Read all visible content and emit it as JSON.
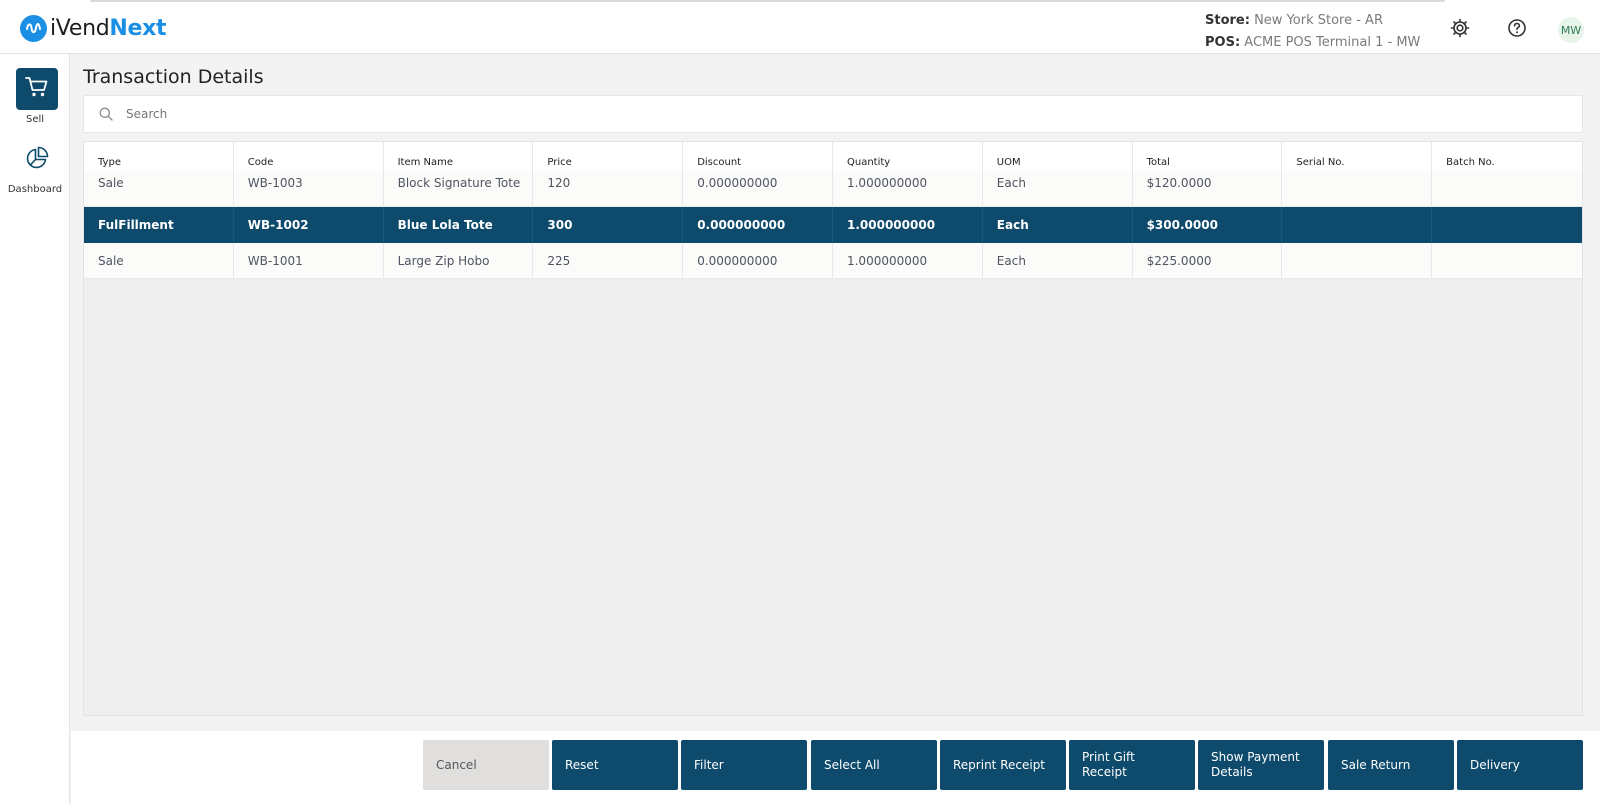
{
  "app": {
    "logo_part1": "iVend",
    "logo_part2": "Next"
  },
  "header": {
    "store_label": "Store:",
    "store_value": "New York Store - AR",
    "pos_label": "POS:",
    "pos_value": "ACME POS Terminal 1 - MW",
    "user_initials": "MW",
    "icons": [
      "gear-icon",
      "help-icon"
    ]
  },
  "sidebar": {
    "items": [
      {
        "label": "Sell",
        "icon": "cart-icon",
        "active": true
      },
      {
        "label": "Dashboard",
        "icon": "pie-chart-icon",
        "active": false
      }
    ]
  },
  "page": {
    "title": "Transaction Details"
  },
  "search": {
    "placeholder": "Search",
    "value": ""
  },
  "table": {
    "columns": [
      "Type",
      "Code",
      "Item Name",
      "Price",
      "Discount",
      "Quantity",
      "UOM",
      "Total",
      "Serial No.",
      "Batch No."
    ],
    "rows": [
      [
        "Sale",
        "WB-1003",
        "Block Signature Tote",
        "120",
        "0.000000000",
        "1.000000000",
        "Each",
        "$120.0000",
        "",
        ""
      ],
      [
        "FulFillment",
        "WB-1002",
        "Blue Lola Tote",
        "300",
        "0.000000000",
        "1.000000000",
        "Each",
        "$300.0000",
        "",
        ""
      ],
      [
        "Sale",
        "WB-1001",
        "Large Zip Hobo",
        "225",
        "0.000000000",
        "1.000000000",
        "Each",
        "$225.0000",
        "",
        ""
      ]
    ],
    "selected_row": 1
  },
  "actions": {
    "cancel": "Cancel",
    "reset": "Reset",
    "filter": "Filter",
    "select_all": "Select All",
    "reprint_receipt": "Reprint Receipt",
    "print_gift_receipt": "Print Gift Receipt",
    "show_payment_details": "Show Payment Details",
    "sale_return": "Sale Return",
    "delivery": "Delivery"
  },
  "colors": {
    "primary": "#0d4a6b",
    "brand_blue": "#1a8fe3",
    "cancel_bg": "#e1dfdd"
  }
}
